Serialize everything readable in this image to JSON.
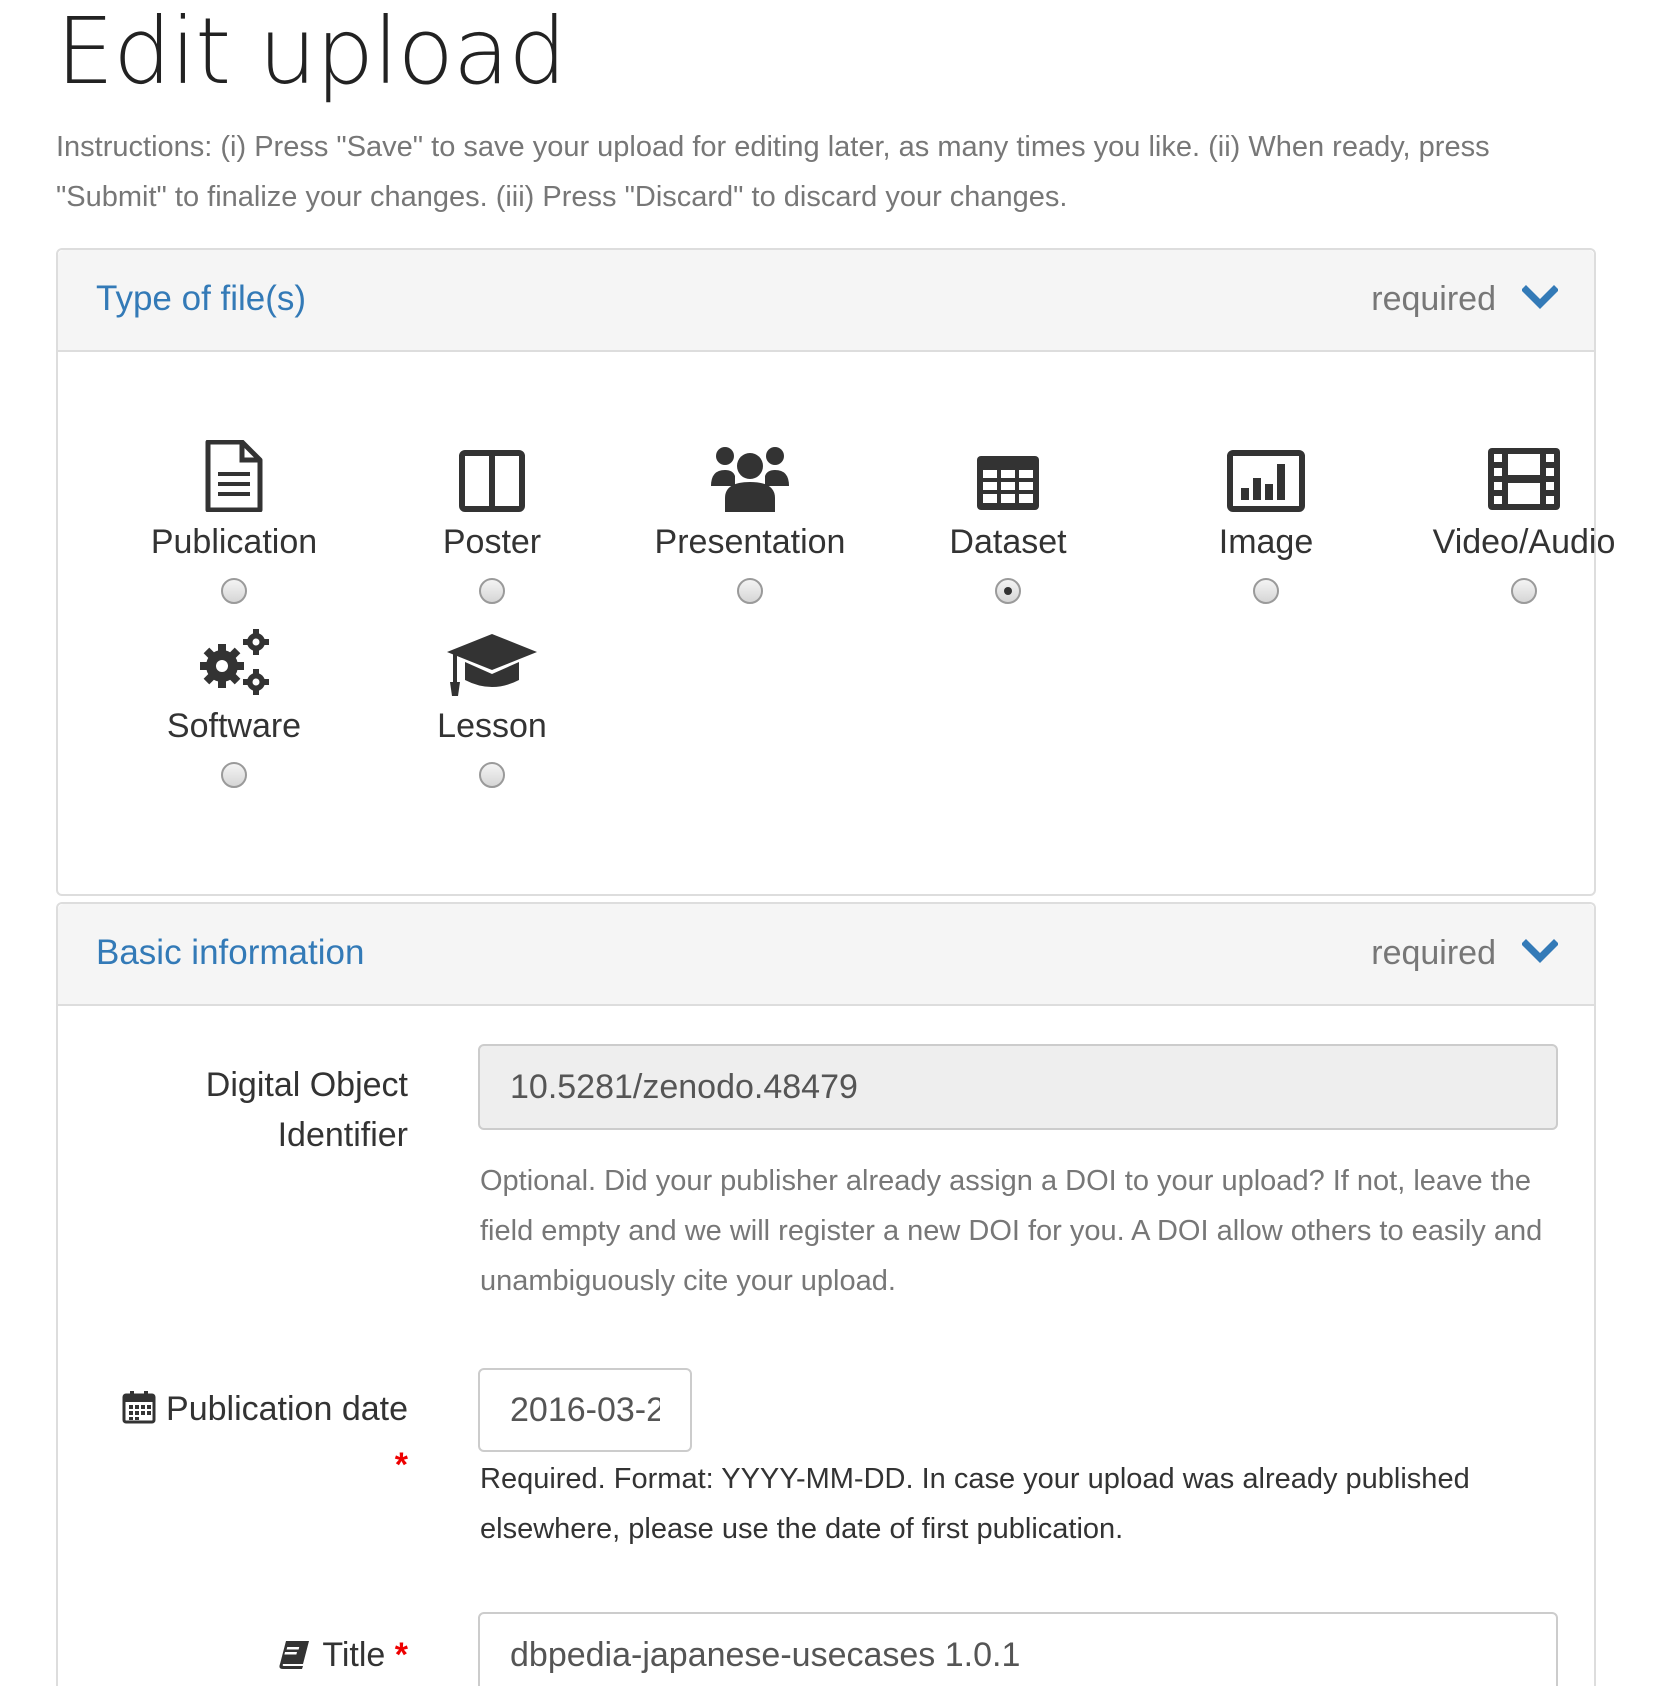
{
  "page": {
    "title": "Edit upload",
    "instructions": "Instructions: (i) Press \"Save\" to save your upload for editing later, as many times you like. (ii) When ready, press \"Submit\" to finalize your changes. (iii) Press \"Discard\" to discard your changes."
  },
  "type_panel": {
    "title": "Type of file(s)",
    "required": "required",
    "types": [
      {
        "label": "Publication",
        "icon": "file-text-icon",
        "checked": false
      },
      {
        "label": "Poster",
        "icon": "columns-icon",
        "checked": false
      },
      {
        "label": "Presentation",
        "icon": "group-icon",
        "checked": false
      },
      {
        "label": "Dataset",
        "icon": "table-icon",
        "checked": true
      },
      {
        "label": "Image",
        "icon": "bar-chart-icon",
        "checked": false
      },
      {
        "label": "Video/Audio",
        "icon": "film-icon",
        "checked": false
      },
      {
        "label": "Software",
        "icon": "gears-icon",
        "checked": false
      },
      {
        "label": "Lesson",
        "icon": "graduation-cap-icon",
        "checked": false
      }
    ]
  },
  "basic_panel": {
    "title": "Basic information",
    "required": "required",
    "doi": {
      "label": "Digital Object Identifier",
      "value": "10.5281/zenodo.48479",
      "help": "Optional. Did your publisher already assign a DOI to your upload? If not, leave the field empty and we will register a new DOI for you. A DOI allow others to easily and unambiguously cite your upload."
    },
    "pub_date": {
      "label": "Publication date",
      "value": "2016-03-2",
      "help": "Required. Format: YYYY-MM-DD. In case your upload was already published elsewhere, please use the date of first publication.",
      "icon": "calendar-icon"
    },
    "title_field": {
      "label": "Title",
      "value": "dbpedia-japanese-usecases 1.0.1",
      "icon": "book-icon"
    },
    "required_mark": "*"
  },
  "colors": {
    "accent": "#337ab7",
    "required": "#e00000",
    "muted": "#777777"
  }
}
